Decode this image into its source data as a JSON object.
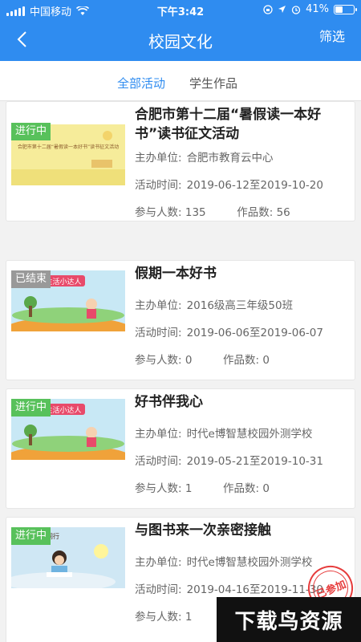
{
  "status_bar": {
    "carrier": "中国移动",
    "time": "下午3:42",
    "battery_text": "41%",
    "battery_level": 0.41
  },
  "nav": {
    "title": "校园文化",
    "filter_label": "筛选"
  },
  "tabs": [
    {
      "label": "全部活动",
      "active": true
    },
    {
      "label": "学生作品",
      "active": false
    }
  ],
  "labels": {
    "organizer": "主办单位:",
    "time": "活动时间:",
    "participants": "参与人数:",
    "works": "作品数:"
  },
  "activities": [
    {
      "status": "进行中",
      "title": "合肥市第十二届“暑假读一本好书”读书征文活动",
      "organizer": "合肥市教育云中心",
      "time": "2019-06-12至2019-10-20",
      "participants": "135",
      "works": "56",
      "thumb_text": "合肥市第十二届“暑假读一本好书”读书征文活动"
    },
    {
      "status": "已结束",
      "title": "假期一本好书",
      "organizer": "2016级高三年级50班",
      "time": "2019-06-06至2019-06-07",
      "participants": "0",
      "works": "0",
      "thumb_text": "生活小达人"
    },
    {
      "status": "进行中",
      "title": "好书伴我心",
      "organizer": "时代e博智慧校园外测学校",
      "time": "2019-05-21至2019-10-31",
      "participants": "1",
      "works": "0",
      "thumb_text": "生活小达人"
    },
    {
      "status": "进行中",
      "title": "与图书来一次亲密接触",
      "organizer": "时代e博智慧校园外测学校",
      "time": "2019-04-16至2019-11-30",
      "participants": "1",
      "thumb_text": "与经典同行",
      "stamp": "已参加"
    }
  ],
  "watermark": "下载鸟资源",
  "colors": {
    "primary": "#2f8cf0",
    "running": "#58c15b",
    "ended": "#999999",
    "stamp": "#e63c3c"
  }
}
